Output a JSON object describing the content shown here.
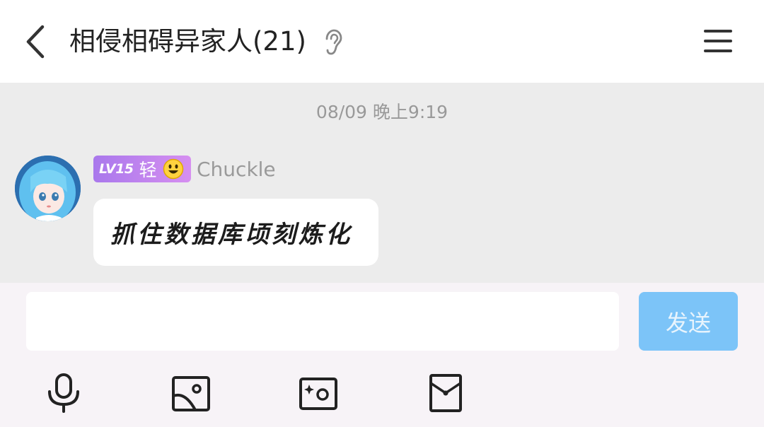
{
  "header": {
    "title": "相侵相碍异家人(21)",
    "back_icon": "chevron-left-icon",
    "ear_icon": "ear-icon",
    "menu_icon": "hamburger-menu-icon"
  },
  "chat": {
    "timestamp": "08/09 晚上9:19",
    "messages": [
      {
        "avatar": "anime-girl-avatar",
        "level": "LV15",
        "badge_char": "轻",
        "badge_emoji": "smiley-face-icon",
        "username": "Chuckle",
        "text": "抓住数据库顷刻炼化"
      }
    ]
  },
  "composer": {
    "input_value": "",
    "input_placeholder": "",
    "send_label": "发送",
    "tools": [
      "microphone-icon",
      "image-icon",
      "photo-effect-icon",
      "red-packet-icon"
    ]
  },
  "colors": {
    "chat_bg": "#ececec",
    "composer_bg": "#f7f3f7",
    "send_button": "#7cc4f8",
    "badge_start": "#a978ec",
    "badge_end": "#d68ff0"
  }
}
